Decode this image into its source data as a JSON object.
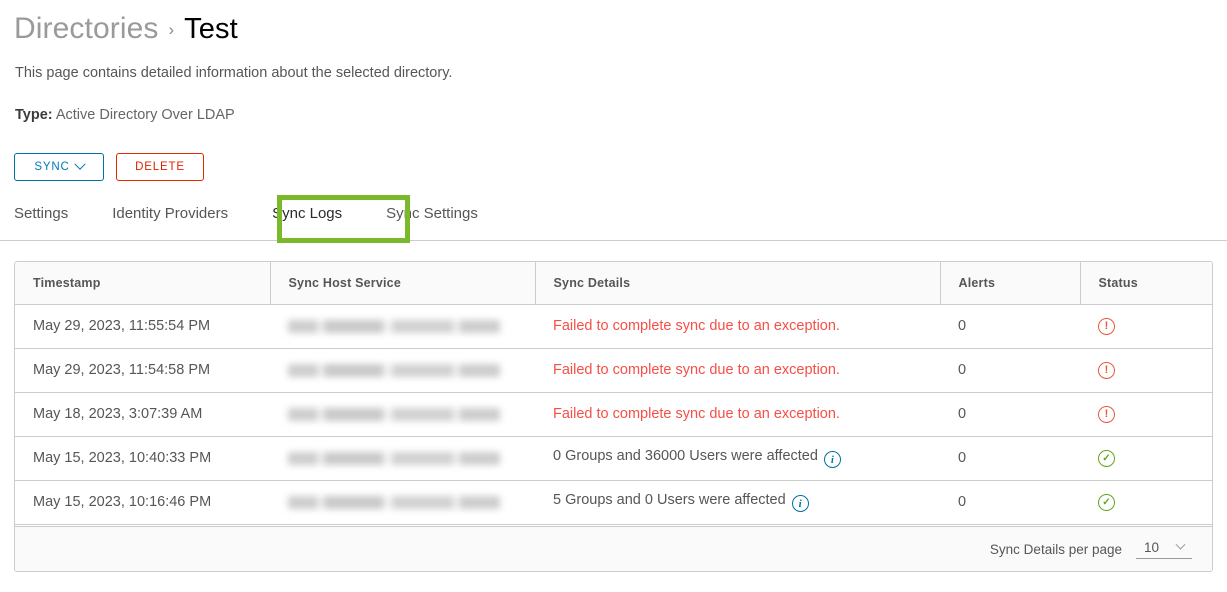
{
  "breadcrumb": {
    "root": "Directories",
    "separator": "›",
    "current": "Test"
  },
  "subtitle": "This page contains detailed information about the selected directory.",
  "type_row": {
    "label": "Type:",
    "value": "Active Directory Over LDAP"
  },
  "actions": {
    "sync_label": "SYNC",
    "delete_label": "DELETE"
  },
  "tabs": [
    {
      "label": "Settings",
      "selected": false
    },
    {
      "label": "Identity Providers",
      "selected": false
    },
    {
      "label": "Sync Logs",
      "selected": true
    },
    {
      "label": "Sync Settings",
      "selected": false
    }
  ],
  "table": {
    "columns": [
      "Timestamp",
      "Sync Host Service",
      "Sync Details",
      "Alerts",
      "Status"
    ],
    "rows": [
      {
        "timestamp": "May 29, 2023, 11:55:54 PM",
        "host": "",
        "host_redacted": true,
        "details": "Failed to complete sync due to an exception.",
        "details_state": "error",
        "has_info": false,
        "alerts": "0",
        "status": "error"
      },
      {
        "timestamp": "May 29, 2023, 11:54:58 PM",
        "host": "",
        "host_redacted": true,
        "details": "Failed to complete sync due to an exception.",
        "details_state": "error",
        "has_info": false,
        "alerts": "0",
        "status": "error"
      },
      {
        "timestamp": "May 18, 2023, 3:07:39 AM",
        "host": "",
        "host_redacted": true,
        "details": "Failed to complete sync due to an exception.",
        "details_state": "error",
        "has_info": false,
        "alerts": "0",
        "status": "error"
      },
      {
        "timestamp": "May 15, 2023, 10:40:33 PM",
        "host": "",
        "host_redacted": true,
        "details": "0 Groups and 36000 Users were affected",
        "details_state": "ok",
        "has_info": true,
        "alerts": "0",
        "status": "success"
      },
      {
        "timestamp": "May 15, 2023, 10:16:46 PM",
        "host": "",
        "host_redacted": true,
        "details": "5 Groups and 0 Users were affected",
        "details_state": "ok",
        "has_info": true,
        "alerts": "0",
        "status": "success"
      }
    ]
  },
  "footer": {
    "per_page_label": "Sync Details per page",
    "per_page_value": "10"
  },
  "icons": {
    "info": "i",
    "status_error": "!",
    "status_success": "✓",
    "chevron_down": "chevron-down-icon"
  },
  "colors": {
    "accent_blue": "#0079b8",
    "danger_red": "#e12000",
    "error_text": "#f54f47",
    "success_green": "#62a420",
    "annotation_green": "#7ab929",
    "border_grey": "#cccccc"
  }
}
